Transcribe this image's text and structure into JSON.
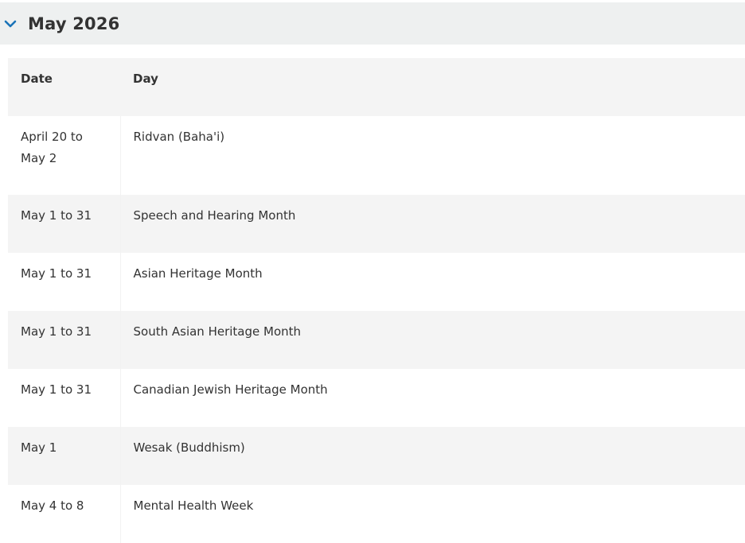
{
  "section": {
    "title": "May 2026",
    "expanded": true,
    "accent_color": "#1a73b8"
  },
  "table": {
    "headers": {
      "date": "Date",
      "day": "Day"
    },
    "rows": [
      {
        "date": "April 20 to May 2",
        "day": "Ridvan (Baha'i)"
      },
      {
        "date": "May 1 to 31",
        "day": "Speech and Hearing Month"
      },
      {
        "date": "May 1 to 31",
        "day": "Asian Heritage Month"
      },
      {
        "date": "May 1 to 31",
        "day": "South Asian Heritage Month"
      },
      {
        "date": "May 1 to 31",
        "day": "Canadian Jewish Heritage Month"
      },
      {
        "date": "May 1",
        "day": "Wesak (Buddhism)"
      },
      {
        "date": "May 4 to 8",
        "day": "Mental Health Week"
      }
    ]
  }
}
